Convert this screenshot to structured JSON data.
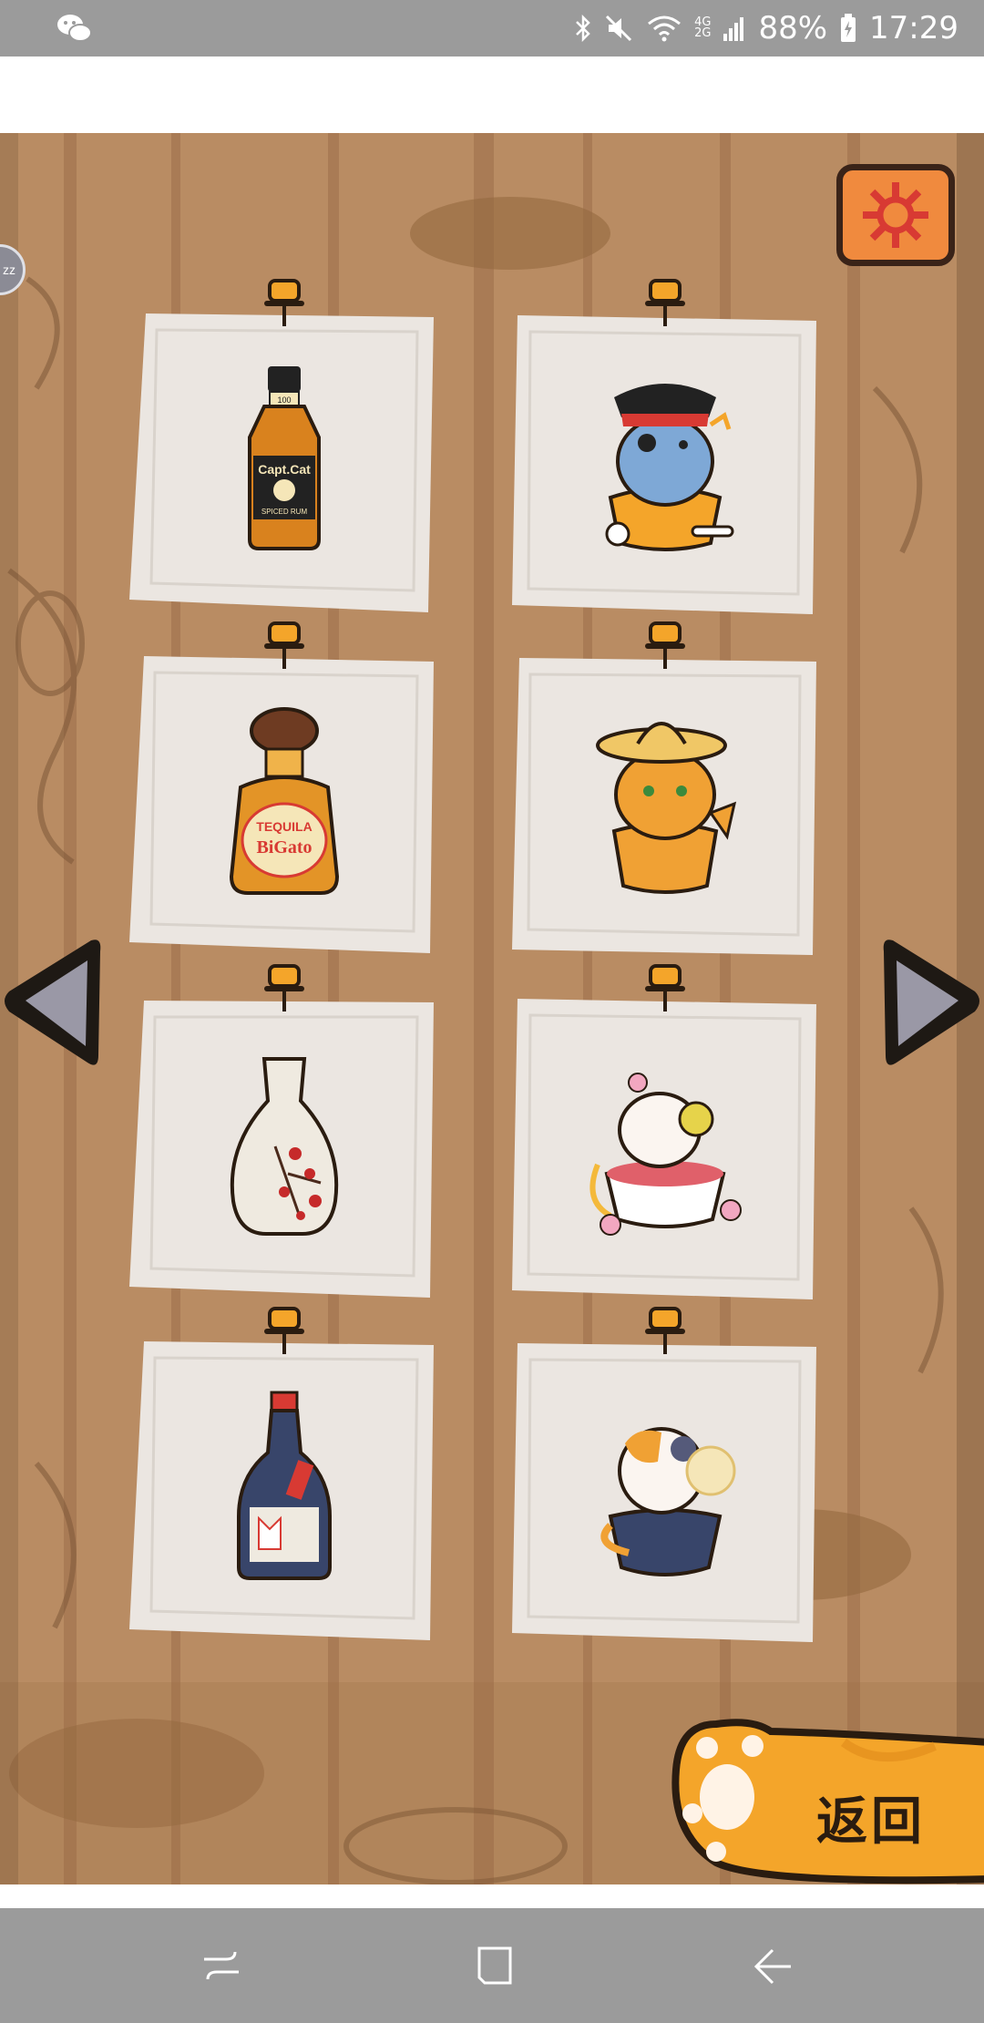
{
  "status_bar": {
    "battery": "88%",
    "time": "17:29",
    "network_top": "4G",
    "network_bottom": "2G",
    "icons": [
      "wechat-icon",
      "bluetooth-icon",
      "mute-icon",
      "wifi-icon",
      "signal-icon",
      "battery-charging-icon"
    ]
  },
  "game": {
    "settings_icon": "gear-icon",
    "side_bubble": "zz",
    "prev_icon": "arrow-left-icon",
    "next_icon": "arrow-right-icon",
    "cards": [
      {
        "item": "captain-cat-rum-bottle",
        "label_line1": "Capt.Cat",
        "label_line2": "SPICED RUM",
        "neck": "100"
      },
      {
        "item": "pirate-cat-in-cup"
      },
      {
        "item": "tequila-bottle",
        "label_line1": "TEQUILA",
        "label_line2": "BiGato"
      },
      {
        "item": "sombrero-cat-in-cup"
      },
      {
        "item": "sake-vase-cherry-blossom"
      },
      {
        "item": "cherry-blossom-cat-in-bowl"
      },
      {
        "item": "sake-bottle-kitsune"
      },
      {
        "item": "calico-cat-in-bowl"
      }
    ],
    "back_label": "返回"
  },
  "nav_bar": {
    "icons": [
      "recent-apps-icon",
      "home-icon",
      "back-icon"
    ]
  },
  "colors": {
    "wood": "#b98c63",
    "paper": "#ebe6e1",
    "gear_button": "#f08a3e",
    "paw": "#f4a52a"
  }
}
